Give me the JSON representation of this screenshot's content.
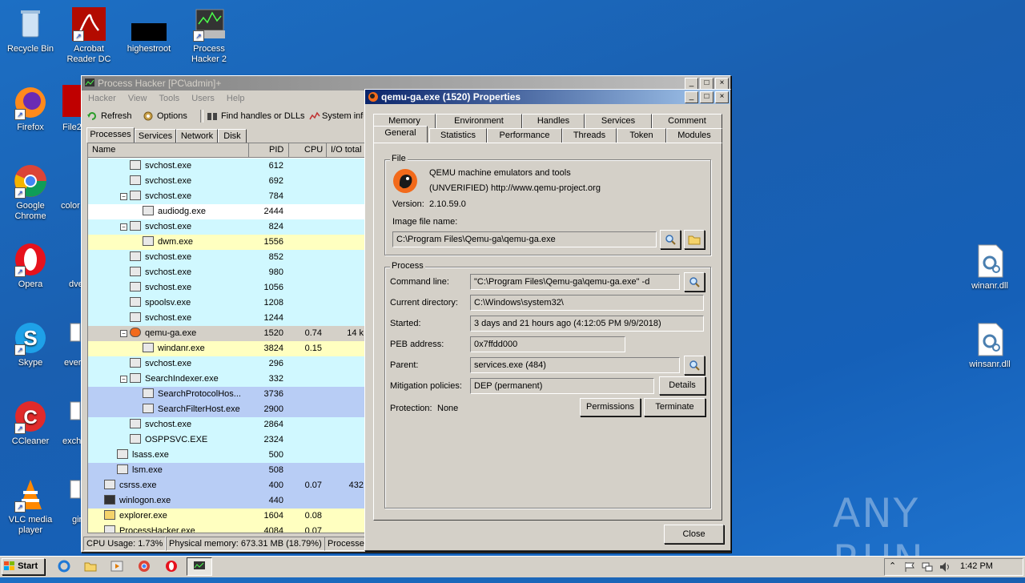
{
  "desktop": {
    "icons_left": [
      {
        "label": "Recycle Bin"
      },
      {
        "label": "Acrobat Reader DC"
      },
      {
        "label": "highestroot"
      },
      {
        "label": "Process Hacker 2"
      },
      {
        "label": "Firefox"
      },
      {
        "label": "File2"
      },
      {
        "label": "Google Chrome"
      },
      {
        "label": "color"
      },
      {
        "label": "Opera"
      },
      {
        "label": "dve"
      },
      {
        "label": "Skype"
      },
      {
        "label": "ever"
      },
      {
        "label": "CCleaner"
      },
      {
        "label": "exch"
      },
      {
        "label": "VLC media player"
      },
      {
        "label": "gir"
      }
    ],
    "icons_right": [
      {
        "label": "winanr.dll"
      },
      {
        "label": "winsanr.dll"
      }
    ],
    "watermark": "ANY RUN"
  },
  "ph_window": {
    "title": "Process Hacker [PC\\admin]+",
    "menu": [
      "Hacker",
      "View",
      "Tools",
      "Users",
      "Help"
    ],
    "toolbar": {
      "refresh": "Refresh",
      "options": "Options",
      "find": "Find handles or DLLs",
      "sysinfo": "System info"
    },
    "tabs": [
      "Processes",
      "Services",
      "Network",
      "Disk"
    ],
    "columns": {
      "name": "Name",
      "pid": "PID",
      "cpu": "CPU",
      "io": "I/O total"
    },
    "rows": [
      {
        "name": "svchost.exe",
        "pid": "612",
        "cpu": "",
        "io": ""
      },
      {
        "name": "svchost.exe",
        "pid": "692",
        "cpu": "",
        "io": ""
      },
      {
        "name": "svchost.exe",
        "pid": "784",
        "cpu": "",
        "io": ""
      },
      {
        "name": "audiodg.exe",
        "pid": "2444",
        "cpu": "",
        "io": ""
      },
      {
        "name": "svchost.exe",
        "pid": "824",
        "cpu": "",
        "io": ""
      },
      {
        "name": "dwm.exe",
        "pid": "1556",
        "cpu": "",
        "io": ""
      },
      {
        "name": "svchost.exe",
        "pid": "852",
        "cpu": "",
        "io": ""
      },
      {
        "name": "svchost.exe",
        "pid": "980",
        "cpu": "",
        "io": ""
      },
      {
        "name": "svchost.exe",
        "pid": "1056",
        "cpu": "",
        "io": ""
      },
      {
        "name": "spoolsv.exe",
        "pid": "1208",
        "cpu": "",
        "io": ""
      },
      {
        "name": "svchost.exe",
        "pid": "1244",
        "cpu": "",
        "io": ""
      },
      {
        "name": "qemu-ga.exe",
        "pid": "1520",
        "cpu": "0.74",
        "io": "14 k"
      },
      {
        "name": "windanr.exe",
        "pid": "3824",
        "cpu": "0.15",
        "io": ""
      },
      {
        "name": "svchost.exe",
        "pid": "296",
        "cpu": "",
        "io": ""
      },
      {
        "name": "SearchIndexer.exe",
        "pid": "332",
        "cpu": "",
        "io": ""
      },
      {
        "name": "SearchProtocolHos...",
        "pid": "3736",
        "cpu": "",
        "io": ""
      },
      {
        "name": "SearchFilterHost.exe",
        "pid": "2900",
        "cpu": "",
        "io": ""
      },
      {
        "name": "svchost.exe",
        "pid": "2864",
        "cpu": "",
        "io": ""
      },
      {
        "name": "OSPPSVC.EXE",
        "pid": "2324",
        "cpu": "",
        "io": ""
      },
      {
        "name": "lsass.exe",
        "pid": "500",
        "cpu": "",
        "io": ""
      },
      {
        "name": "lsm.exe",
        "pid": "508",
        "cpu": "",
        "io": ""
      },
      {
        "name": "csrss.exe",
        "pid": "400",
        "cpu": "0.07",
        "io": "432"
      },
      {
        "name": "winlogon.exe",
        "pid": "440",
        "cpu": "",
        "io": ""
      },
      {
        "name": "explorer.exe",
        "pid": "1604",
        "cpu": "0.08",
        "io": ""
      },
      {
        "name": "ProcessHacker.exe",
        "pid": "4084",
        "cpu": "0.07",
        "io": ""
      }
    ],
    "status": {
      "cpu": "CPU Usage: 1.73%",
      "mem": "Physical memory: 673.31 MB (18.79%)",
      "procs": "Processes"
    }
  },
  "props": {
    "title": "qemu-ga.exe (1520) Properties",
    "tabs_top": [
      "Memory",
      "Environment",
      "Handles",
      "Services",
      "Comment"
    ],
    "tabs_bottom": [
      "General",
      "Statistics",
      "Performance",
      "Threads",
      "Token",
      "Modules"
    ],
    "file_group": "File",
    "description": "QEMU machine emulators and tools",
    "company": "(UNVERIFIED) http://www.qemu-project.org",
    "version_label": "Version:",
    "version": "2.10.59.0",
    "image_label": "Image file name:",
    "image_path": "C:\\Program Files\\Qemu-ga\\qemu-ga.exe",
    "process_group": "Process",
    "cmdline_label": "Command line:",
    "cmdline": "\"C:\\Program Files\\Qemu-ga\\qemu-ga.exe\" -d",
    "curdir_label": "Current directory:",
    "curdir": "C:\\Windows\\system32\\",
    "started_label": "Started:",
    "started": "3 days and 21 hours ago (4:12:05 PM 9/9/2018)",
    "peb_label": "PEB address:",
    "peb": "0x7ffdd000",
    "parent_label": "Parent:",
    "parent": "services.exe (484)",
    "mitigation_label": "Mitigation policies:",
    "mitigation": "DEP (permanent)",
    "details_btn": "Details",
    "protection_label": "Protection:",
    "protection": "None",
    "permissions_btn": "Permissions",
    "terminate_btn": "Terminate",
    "close_btn": "Close"
  },
  "taskbar": {
    "start": "Start",
    "clock": "1:42 PM"
  },
  "colors": {
    "service": "#d0f8ff",
    "own": "#ffffc0",
    "selected": "#d4d0c8",
    "system": "#b8cdf5",
    "plain": "#ffffff"
  }
}
